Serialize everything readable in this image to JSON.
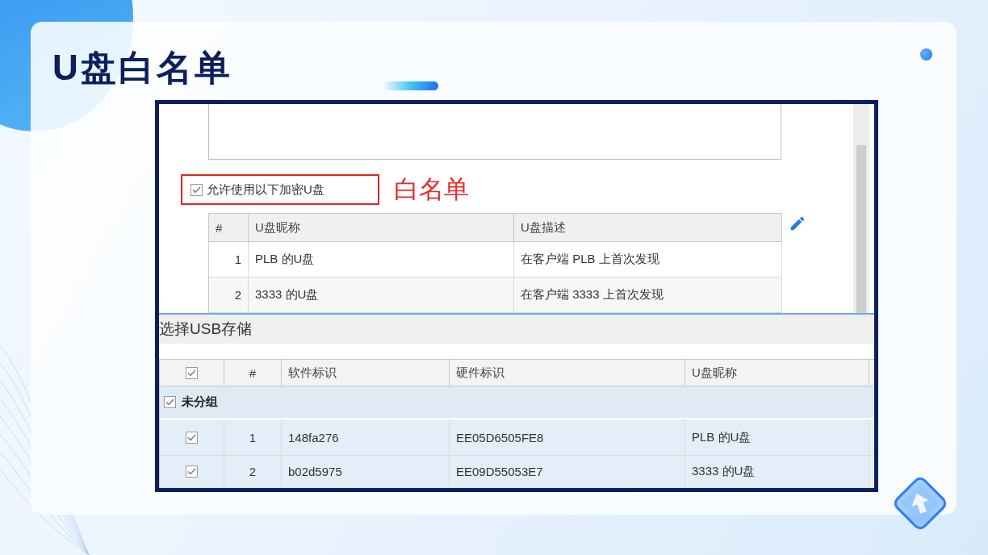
{
  "slide": {
    "title": "U盘白名单"
  },
  "whitelist_panel": {
    "allow_encrypted": {
      "label": "允许使用以下加密U盘",
      "checked": true
    },
    "annotation": "白名单",
    "table": {
      "columns": [
        "#",
        "U盘昵称",
        "U盘描述"
      ],
      "rows": [
        {
          "index": "1",
          "nickname": "PLB 的U盘",
          "description": "在客户端 PLB 上首次发现"
        },
        {
          "index": "2",
          "nickname": "3333 的U盘",
          "description": "在客户端 3333 上首次发现"
        }
      ]
    }
  },
  "usb_storage": {
    "title": "选择USB存储",
    "select_all_checked": true,
    "columns": [
      "#",
      "软件标识",
      "硬件标识",
      "U盘昵称"
    ],
    "groups": [
      {
        "name": "未分组",
        "checked": true,
        "rows": [
          {
            "index": "1",
            "software_id": "148fa276",
            "hardware_id": "EE05D6505FE8",
            "nickname": "PLB 的U盘",
            "checked": true
          },
          {
            "index": "2",
            "software_id": "b02d5975",
            "hardware_id": "EE09D55053E7",
            "nickname": "3333 的U盘",
            "checked": true
          }
        ]
      }
    ]
  }
}
